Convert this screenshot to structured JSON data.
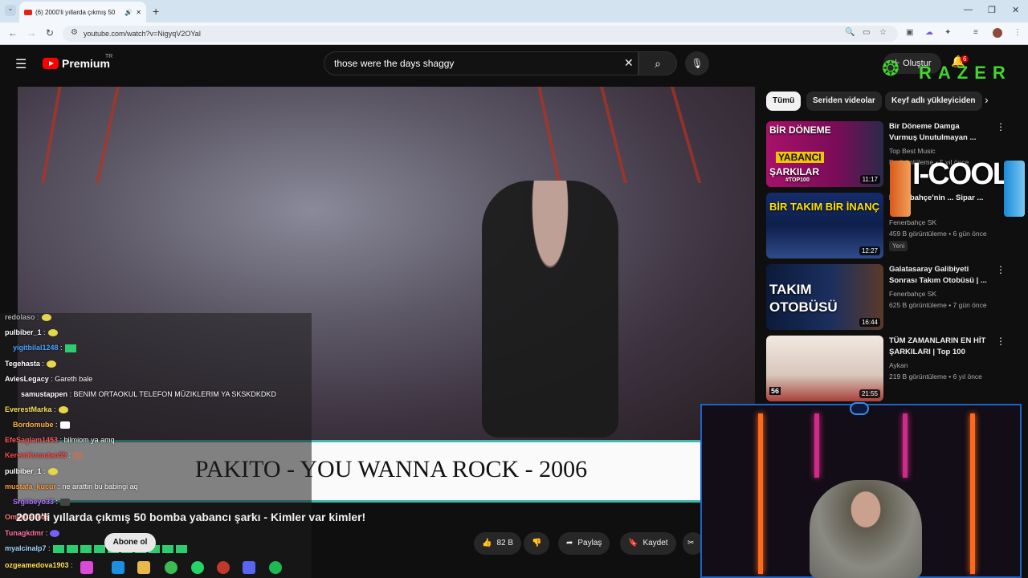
{
  "browser": {
    "tab_title": "(6) 2000'li yıllarda çıkmış 50",
    "url": "youtube.com/watch?v=NigyqV2OYaI",
    "new_tab": "+"
  },
  "header": {
    "logo": "Premium",
    "country": "TR",
    "search_value": "those were the days shaggy",
    "create_label": "Oluştur",
    "notifications": "6",
    "overlay_brand": "RAZER"
  },
  "video": {
    "caption": "PAKITO - YOU WANNA ROCK - 2006",
    "title": "2000'li yıllarda çıkmış 50 bomba yabancı şarkı - Kimler var kimler!",
    "subscribe_label": "Abone ol",
    "likes": "82 B",
    "share_label": "Paylaş",
    "save_label": "Kaydet"
  },
  "chat": [
    {
      "user": "redolaso",
      "msg": ""
    },
    {
      "user": "pulbiber_1",
      "msg": ""
    },
    {
      "user": "yigitbilal1248",
      "msg": ""
    },
    {
      "user": "Tegehasta",
      "msg": ""
    },
    {
      "user": "AviesLegacy",
      "msg": "Gareth bale"
    },
    {
      "user": "samustappen",
      "msg": "BENIM ORTAOKUL TELEFON MÜZIKLERIM YA SKSKDKDKD"
    },
    {
      "user": "EverestMarka",
      "msg": ""
    },
    {
      "user": "Bordomube",
      "msg": ""
    },
    {
      "user": "EfeSaglam1453",
      "msg": "bilmiom ya amq"
    },
    {
      "user": "KeremKomutan59",
      "msg": ""
    },
    {
      "user": "pulbiber_1",
      "msg": ""
    },
    {
      "user": "mustafa_kucur",
      "msg": "ne arattin bu babingi aq"
    },
    {
      "user": "Srgilbeyo33",
      "msg": ""
    },
    {
      "user": "OmerCelik06",
      "msg": ""
    },
    {
      "user": "Tunagkdmr",
      "msg": ""
    },
    {
      "user": "myalcinalp7",
      "msg": ""
    },
    {
      "user": "ozgeamedova1903",
      "msg": ""
    }
  ],
  "sidebar": {
    "chips": [
      "Tümü",
      "Seriden videolar",
      "Keyf adlı yükleyiciden"
    ],
    "videos": [
      {
        "thumb_text_1": "BİR DÖNEME",
        "thumb_text_2": "YABANCI",
        "thumb_text_3": "ŞARKILAR",
        "thumb_text_4": "#TOP100",
        "duration": "11:17",
        "title": "Bir Döneme Damga Vurmuş Unutulmayan ...",
        "channel": "Top Best Music",
        "meta": "B görüntüleme • 5 yıl önce"
      },
      {
        "thumb_text_1": "BİR TAKIM BİR İNANÇ",
        "duration": "12:27",
        "title": "Fenerbahçe'nin ... Sipar ...",
        "channel": "Fenerbahçe SK",
        "meta": "459 B görüntüleme • 6 gün önce",
        "badge": "Yeni"
      },
      {
        "thumb_text_1": "TAKIM",
        "thumb_text_2": "OTOBÜSÜ",
        "duration": "16:44",
        "title": "Galatasaray Galibiyeti Sonrası Takım Otobüsü | ...",
        "channel": "Fenerbahçe SK",
        "meta": "625 B görüntüleme • 7 gün önce"
      },
      {
        "thumb_text_1": "56",
        "duration": "21:55",
        "title": "TÜM ZAMANLARIN EN HİT ŞARKILARI | Top 100",
        "channel": "Aykan",
        "meta": "219 B görüntüleme • 6 yıl önce"
      }
    ],
    "overlay_ad": "I-COOL"
  }
}
